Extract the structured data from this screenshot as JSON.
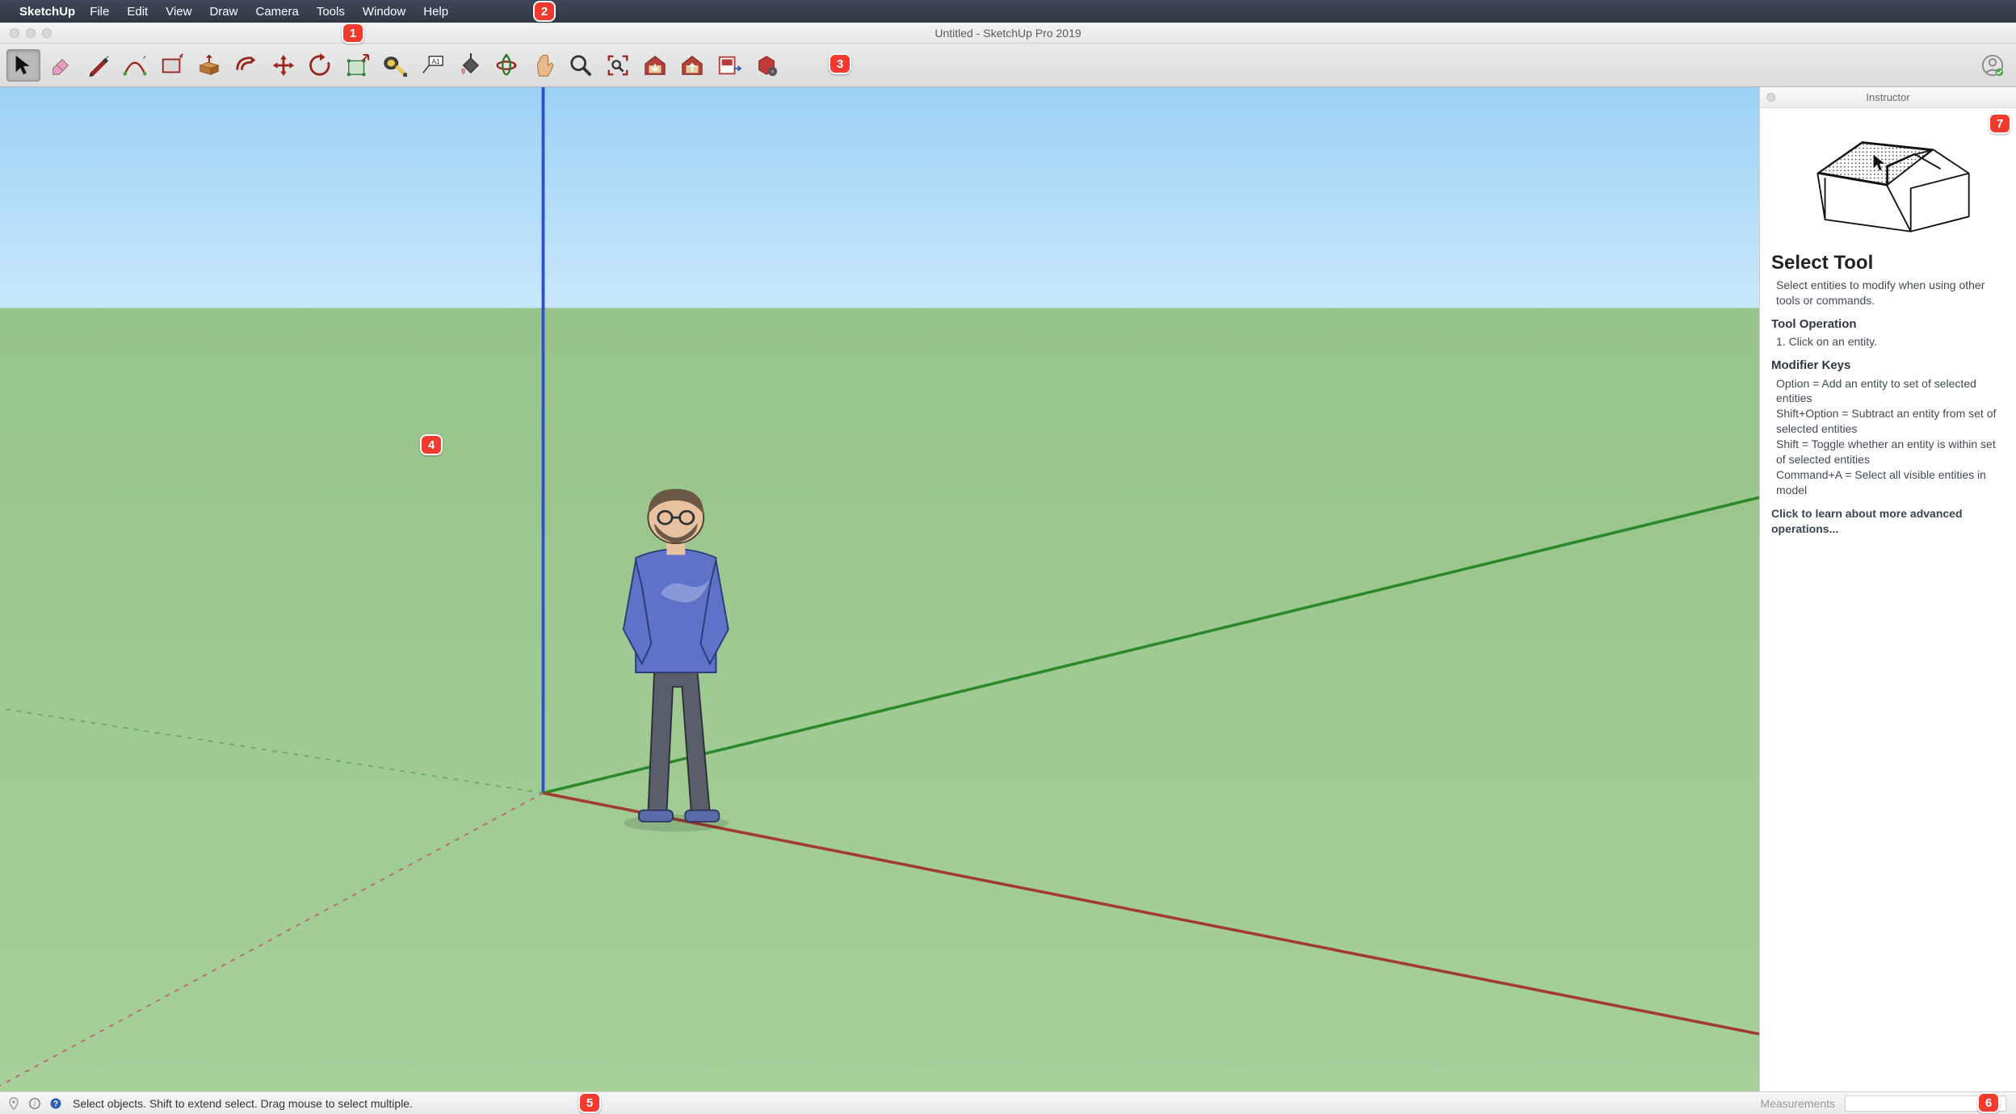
{
  "menubar": {
    "app_name": "SketchUp",
    "items": [
      "File",
      "Edit",
      "View",
      "Draw",
      "Camera",
      "Tools",
      "Window",
      "Help"
    ]
  },
  "window": {
    "title": "Untitled - SketchUp Pro 2019"
  },
  "toolbar": {
    "tools": [
      {
        "name": "select",
        "selected": true
      },
      {
        "name": "eraser",
        "selected": false
      },
      {
        "name": "line",
        "selected": false
      },
      {
        "name": "arc",
        "selected": false
      },
      {
        "name": "rectangle",
        "selected": false
      },
      {
        "name": "push-pull",
        "selected": false
      },
      {
        "name": "offset",
        "selected": false
      },
      {
        "name": "move",
        "selected": false
      },
      {
        "name": "rotate",
        "selected": false
      },
      {
        "name": "scale",
        "selected": false
      },
      {
        "name": "tape-measure",
        "selected": false
      },
      {
        "name": "text",
        "selected": false
      },
      {
        "name": "paint-bucket",
        "selected": false
      },
      {
        "name": "orbit",
        "selected": false
      },
      {
        "name": "pan",
        "selected": false
      },
      {
        "name": "zoom",
        "selected": false
      },
      {
        "name": "zoom-extents",
        "selected": false
      },
      {
        "name": "3d-warehouse",
        "selected": false
      },
      {
        "name": "share-component",
        "selected": false
      },
      {
        "name": "layout",
        "selected": false
      },
      {
        "name": "extensions",
        "selected": false
      }
    ]
  },
  "status": {
    "hint": "Select objects. Shift to extend select. Drag mouse to select multiple.",
    "measurements_label": "Measurements",
    "measurements_value": ""
  },
  "instructor": {
    "panel_title": "Instructor",
    "title": "Select Tool",
    "description": "Select entities to modify when using other tools or commands.",
    "operation_heading": "Tool Operation",
    "operation_text": "1. Click on an entity.",
    "modifiers_heading": "Modifier Keys",
    "modifiers": [
      "Option = Add an entity to set of selected entities",
      "Shift+Option = Subtract an entity from set of selected entities",
      "Shift = Toggle whether an entity is within set of selected entities",
      "Command+A = Select all visible entities in model"
    ],
    "learn_more": "Click to learn about more advanced operations..."
  },
  "callouts": {
    "1": "1",
    "2": "2",
    "3": "3",
    "4": "4",
    "5": "5",
    "6": "6",
    "7": "7"
  }
}
